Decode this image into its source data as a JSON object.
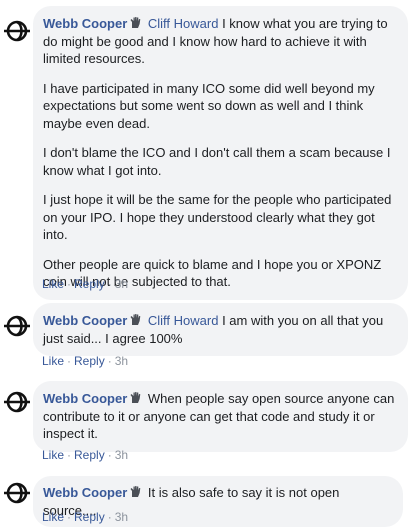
{
  "comments": [
    {
      "author": "Webb Cooper",
      "mention": "Cliff Howard",
      "paragraphs": [
        "I know what you are trying to do might be good and I know how hard to achieve it with limited resources.",
        "I have participated in many ICO some did well beyond my expectations but some went so down as well and I think maybe even dead.",
        "I don't blame the ICO and I don't call them a scam because I know what I got into.",
        "I just hope it will be the same for the people who participated on your IPO. I hope they understood clearly what they got into.",
        "Other people are quick to blame and I hope you or XPONZ coin will not be subjected to that."
      ],
      "like": "Like",
      "reply": "Reply",
      "time": "3h"
    },
    {
      "author": "Webb Cooper",
      "mention": "Cliff Howard",
      "paragraphs": [
        "I am with you on all that you just said... I agree 100%"
      ],
      "like": "Like",
      "reply": "Reply",
      "time": "3h"
    },
    {
      "author": "Webb Cooper",
      "mention": "",
      "paragraphs": [
        "When people say open source anyone can contribute to it or anyone can get that code and study it or inspect it."
      ],
      "like": "Like",
      "reply": "Reply",
      "time": "3h"
    },
    {
      "author": "Webb Cooper",
      "mention": "",
      "paragraphs": [
        "It is also safe to say it is not open source...."
      ],
      "like": "Like",
      "reply": "Reply",
      "time": "3h"
    }
  ],
  "icons": {
    "avatar": "logo-avatar-icon",
    "badge": "hand-icon"
  },
  "colors": {
    "link": "#385898",
    "bubble": "#f2f3f5",
    "meta": "#8d949e",
    "text": "#1c1e21"
  }
}
